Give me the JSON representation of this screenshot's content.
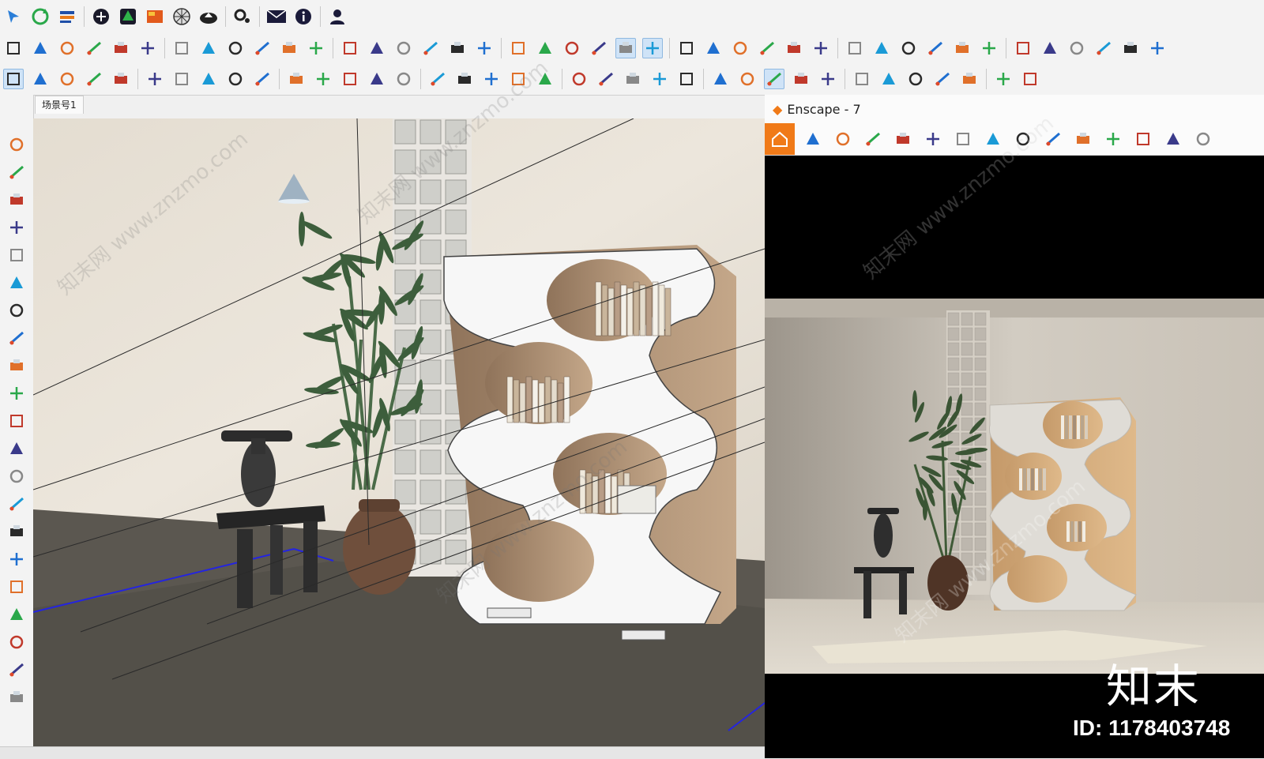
{
  "app": {
    "scene_tab": "场景号1"
  },
  "toolbar_row1": [
    "select-icon",
    "refresh-icon",
    "layers-icon",
    "add-circle-icon",
    "tree-icon",
    "layout-icon",
    "globe-grid-icon",
    "cloud-upload-icon",
    "gear-cluster-icon",
    "mail-icon",
    "info-icon",
    "user-icon"
  ],
  "toolbar_row2": [
    "cube-outline-icon",
    "cube-face-icon",
    "box-icon",
    "box-solid-icon",
    "layers-stack-icon",
    "box-blue-icon",
    "house-icon",
    "door-icon",
    "home-icon",
    "building-icon",
    "house-outline-icon",
    "roof-icon",
    "group-icon",
    "group2-icon",
    "group3-icon",
    "group4-icon",
    "group5-icon",
    "group6-icon",
    "section-icon",
    "section-box-icon",
    "section-fill-icon",
    "section-cut-icon",
    "pointer-icon",
    "panel-icon",
    "export-icon",
    "stairs-icon",
    "eyedropper-icon",
    "paint-icon",
    "eyedropper2-icon",
    "tape-icon",
    "line-icon",
    "dimension-icon",
    "protractor-icon",
    "pencil-icon",
    "grid-icon",
    "box-orange-icon",
    "shape-icon",
    "hammer-icon",
    "arrow-icon",
    "cross-icon",
    "curve-icon",
    "more-icon"
  ],
  "toolbar_row3": [
    "select-arrow-icon",
    "eraser-icon",
    "pencil-icon",
    "arc-icon",
    "rectangle-icon",
    "push-pull-icon",
    "follow-me-icon",
    "move-icon",
    "rotate-icon",
    "scale-icon",
    "tape-measure-icon",
    "text-icon",
    "paint-bucket-icon",
    "orbit-icon",
    "pan-icon",
    "zoom-icon",
    "zoom-extents-icon",
    "warehouse-icon",
    "layers-icon",
    "sandbox-icon",
    "styles-icon",
    "profile-icon",
    "enscape-logo-icon",
    "box-view-icon",
    "sphere-icon",
    "video-icon",
    "camera-icon",
    "sun-icon",
    "settings-gear-icon",
    "cube-view-icon",
    "dot-icon",
    "light-icon",
    "line-icon",
    "square-icon",
    "eye-hidden-icon",
    "link-icon",
    "cloud-icon"
  ],
  "left_toolbar": [
    "select-arrow-icon",
    "orbit-icon",
    "eraser-icon",
    "pencil-icon",
    "freehand-icon",
    "rectangle-icon",
    "circle-icon",
    "arc-icon",
    "pie-icon",
    "push-pull-icon",
    "follow-me-icon",
    "rotate-icon",
    "axes-icon",
    "text-icon",
    "3d-text-icon",
    "pan-icon",
    "zoom-icon",
    "zoom-window-icon",
    "eye-icon",
    "position-camera-icon",
    "sandbox-icon"
  ],
  "enscape": {
    "title": "Enscape - 7",
    "toolbar": [
      "home-icon",
      "location-icon",
      "bim-icon",
      "binoculars-icon",
      "asset-icon",
      "building-icon",
      "clapper-icon",
      "batch-render-icon",
      "settings-doc-icon",
      "expand-icon",
      "map-icon",
      "screenshot-icon",
      "cube-icon",
      "view-icon",
      "extra-icon"
    ]
  },
  "watermark": {
    "brand": "知末",
    "id_text": "ID: 1178403748",
    "site_text": "知末网 www.znzmo.com"
  }
}
